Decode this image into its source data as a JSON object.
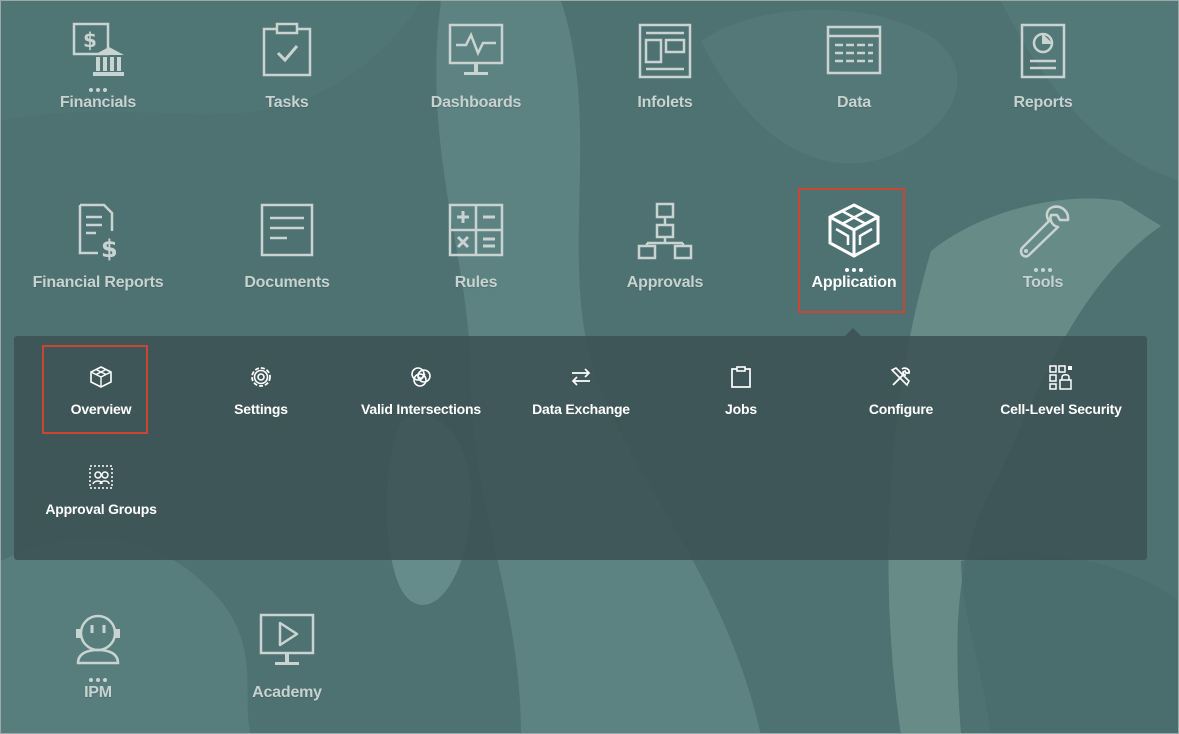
{
  "accent": "#c94534",
  "tiles": [
    {
      "label": "Financials",
      "icon": "financials-icon",
      "dots": true
    },
    {
      "label": "Tasks",
      "icon": "tasks-clipboard-icon",
      "dots": false
    },
    {
      "label": "Dashboards",
      "icon": "dashboard-monitor-icon",
      "dots": false
    },
    {
      "label": "Infolets",
      "icon": "infolets-icon",
      "dots": false
    },
    {
      "label": "Data",
      "icon": "data-grid-icon",
      "dots": false
    },
    {
      "label": "Reports",
      "icon": "reports-icon",
      "dots": false
    },
    {
      "label": "Financial Reports",
      "icon": "financial-reports-icon",
      "dots": false
    },
    {
      "label": "Documents",
      "icon": "documents-icon",
      "dots": false
    },
    {
      "label": "Rules",
      "icon": "rules-calculator-icon",
      "dots": false
    },
    {
      "label": "Approvals",
      "icon": "approvals-hierarchy-icon",
      "dots": false
    },
    {
      "label": "Application",
      "icon": "application-cube-icon",
      "dots": true,
      "selected": true
    },
    {
      "label": "Tools",
      "icon": "tools-wrench-icon",
      "dots": true
    },
    {
      "label": "IPM",
      "icon": "ipm-robot-icon",
      "dots": true
    },
    {
      "label": "Academy",
      "icon": "academy-play-icon",
      "dots": false
    }
  ],
  "submenu": [
    {
      "label": "Overview",
      "icon": "overview-cube-icon",
      "selected": true
    },
    {
      "label": "Settings",
      "icon": "settings-gear-icon"
    },
    {
      "label": "Valid Intersections",
      "icon": "valid-intersections-icon"
    },
    {
      "label": "Data Exchange",
      "icon": "data-exchange-arrows-icon"
    },
    {
      "label": "Jobs",
      "icon": "jobs-clipboard-icon"
    },
    {
      "label": "Configure",
      "icon": "configure-tools-icon"
    },
    {
      "label": "Cell-Level Security",
      "icon": "cell-level-security-icon"
    },
    {
      "label": "Approval Groups",
      "icon": "approval-groups-icon"
    }
  ]
}
